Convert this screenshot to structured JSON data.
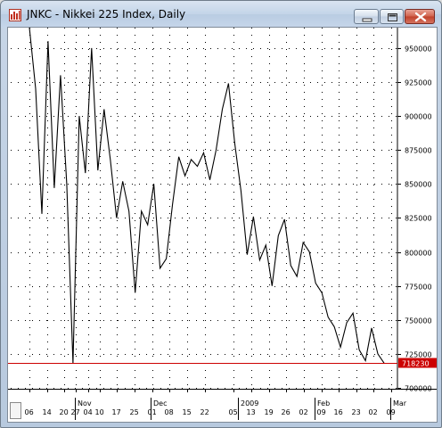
{
  "window": {
    "title": "JNKC - Nikkei 225 Index, Daily",
    "minimize_label": "",
    "maximize_label": "",
    "close_label": ""
  },
  "colors": {
    "price_line": "#000000",
    "last_price_line": "#cc0000",
    "last_price_badge": "#cc0000",
    "grid_dots": "#000000"
  },
  "chart_data": {
    "type": "line",
    "symbol": "JNKC",
    "instrument": "Nikkei 225 Index",
    "period": "Daily",
    "y_ticks": [
      "950000",
      "925000",
      "900000",
      "875000",
      "850000",
      "825000",
      "800000",
      "775000",
      "750000",
      "725000",
      "700000"
    ],
    "y_tick_values": [
      950000,
      925000,
      900000,
      875000,
      850000,
      825000,
      800000,
      775000,
      750000,
      725000,
      700000
    ],
    "ylim": [
      700000,
      965000
    ],
    "last_price_label": "718230",
    "last_price": 718230,
    "month_labels": [
      "Nov",
      "Dec",
      "2009",
      "Feb",
      "Mar"
    ],
    "month_label_day_index": [
      9,
      22,
      37,
      50,
      63
    ],
    "day_labels": [
      "06",
      "14",
      "20",
      "27",
      "04",
      "10",
      "17",
      "25",
      "01",
      "08",
      "15",
      "22",
      "05",
      "13",
      "19",
      "26",
      "02",
      "09",
      "16",
      "23",
      "02",
      "09"
    ],
    "day_label_day_index": [
      0,
      3,
      6,
      8,
      10,
      12,
      15,
      18,
      21,
      24,
      27,
      30,
      35,
      38,
      41,
      44,
      47,
      50,
      53,
      56,
      59,
      62
    ],
    "grid": true,
    "x": [
      0,
      1,
      2,
      3,
      4,
      5,
      6,
      7,
      8,
      9,
      10,
      11,
      12,
      13,
      14,
      15,
      16,
      17,
      18,
      19,
      20,
      21,
      22,
      23,
      24,
      25,
      26,
      27,
      28,
      29,
      30,
      31,
      32,
      33,
      34,
      35,
      36,
      37,
      38,
      39,
      40,
      41,
      42,
      43,
      44,
      45,
      46,
      47,
      48,
      49,
      50,
      51,
      52,
      53,
      54,
      55,
      56,
      57,
      58,
      59,
      60,
      61,
      62,
      63,
      64,
      65
    ],
    "values": [
      965000,
      920000,
      828000,
      955000,
      847000,
      930000,
      850000,
      718000,
      900000,
      858000,
      950000,
      860000,
      905000,
      868000,
      825000,
      852000,
      830000,
      770000,
      830000,
      820000,
      850000,
      788000,
      795000,
      835000,
      870000,
      856000,
      868000,
      863000,
      873000,
      853000,
      875000,
      905000,
      924000,
      880000,
      845000,
      798000,
      826000,
      794000,
      805000,
      775000,
      812000,
      824000,
      790000,
      782000,
      807000,
      800000,
      777000,
      770000,
      752000,
      745000,
      730000,
      748000,
      755000,
      728000,
      720000,
      744000,
      725000,
      718230
    ],
    "values_note": ""
  }
}
